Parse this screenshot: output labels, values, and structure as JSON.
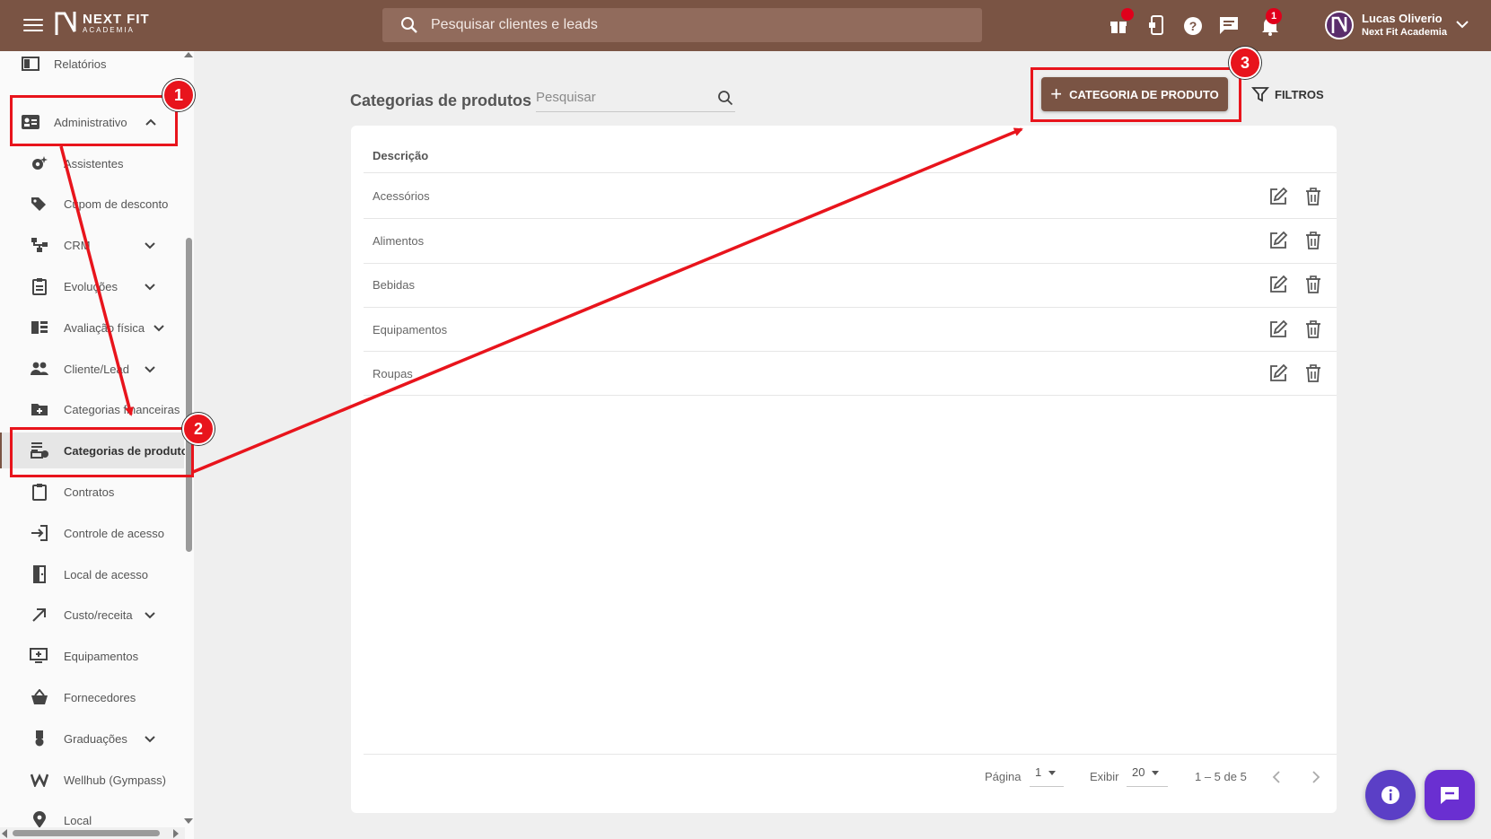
{
  "topbar": {
    "logo_line1": "NEXT FIT",
    "logo_line2": "ACADEMIA",
    "search_placeholder": "Pesquisar clientes e leads",
    "notification_count": "1",
    "user_name": "Lucas Oliverio",
    "user_company": "Next Fit Academia",
    "icons": [
      "gift-icon",
      "phone-lock-icon",
      "help-icon",
      "chat-icon",
      "bell-icon"
    ]
  },
  "sidebar": {
    "items": [
      {
        "label": "Relatórios",
        "icon": "report-icon"
      },
      {
        "label": "Administrativo",
        "icon": "id-card-icon"
      },
      {
        "label": "Assistentes",
        "icon": "gear-sparkle-icon"
      },
      {
        "label": "Cupom de desconto",
        "icon": "tags-icon"
      },
      {
        "label": "CRM",
        "icon": "crm-icon"
      },
      {
        "label": "Evoluções",
        "icon": "clipboard-icon"
      },
      {
        "label": "Avaliação física",
        "icon": "list-icon"
      },
      {
        "label": "Cliente/Lead",
        "icon": "users-icon"
      },
      {
        "label": "Categorias financeiras",
        "icon": "folder-plus-icon"
      },
      {
        "label": "Categorias de produtos",
        "icon": "product-category-icon"
      },
      {
        "label": "Contratos",
        "icon": "clipboard-blank-icon"
      },
      {
        "label": "Controle de acesso",
        "icon": "login-icon"
      },
      {
        "label": "Local de acesso",
        "icon": "door-icon"
      },
      {
        "label": "Custo/receita",
        "icon": "arrow-up-right-icon"
      },
      {
        "label": "Equipamentos",
        "icon": "monitor-plus-icon"
      },
      {
        "label": "Fornecedores",
        "icon": "basket-icon"
      },
      {
        "label": "Graduações",
        "icon": "medal-icon"
      },
      {
        "label": "Wellhub (Gympass)",
        "icon": "wellhub-icon"
      },
      {
        "label": "Local",
        "icon": "pin-icon"
      }
    ]
  },
  "main": {
    "title": "Categorias de produtos",
    "search_placeholder": "Pesquisar",
    "add_button": "CATEGORIA DE PRODUTO",
    "filter_button": "FILTROS",
    "table": {
      "header": "Descrição",
      "rows": [
        "Acessórios",
        "Alimentos",
        "Bebidas",
        "Equipamentos",
        "Roupas"
      ]
    },
    "footer": {
      "page_label": "Página",
      "page_value": "1",
      "show_label": "Exibir",
      "show_value": "20",
      "range": "1 – 5 de 5"
    }
  },
  "annotations": {
    "badges": [
      "1",
      "2",
      "3"
    ],
    "color": "#e8141c"
  },
  "colors": {
    "brand": "#7a5444",
    "search_bg": "#916b5c",
    "fab_info": "#5b3fc6",
    "fab_chat": "#6a2fd1"
  }
}
